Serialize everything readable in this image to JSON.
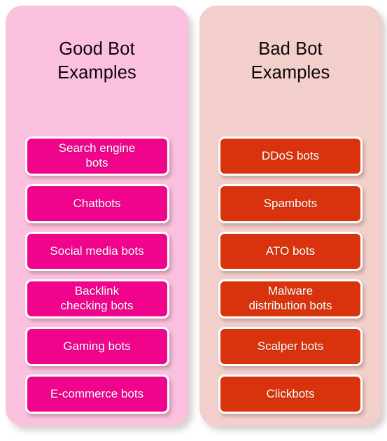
{
  "panels": [
    {
      "id": "good-bot",
      "title": "Good Bot\nExamples",
      "panel_color": "#fbc0de",
      "pill_color": "#f0048c",
      "items": [
        {
          "label": "Search engine\nbots"
        },
        {
          "label": "Chatbots"
        },
        {
          "label": "Social media bots"
        },
        {
          "label": "Backlink\nchecking bots"
        },
        {
          "label": "Gaming bots"
        },
        {
          "label": "E-commerce bots"
        }
      ]
    },
    {
      "id": "bad-bot",
      "title": "Bad Bot\nExamples",
      "panel_color": "#f2cfcb",
      "pill_color": "#d8330c",
      "items": [
        {
          "label": "DDoS bots"
        },
        {
          "label": "Spambots"
        },
        {
          "label": "ATO bots"
        },
        {
          "label": "Malware\ndistribution bots"
        },
        {
          "label": "Scalper bots"
        },
        {
          "label": "Clickbots"
        }
      ]
    }
  ]
}
